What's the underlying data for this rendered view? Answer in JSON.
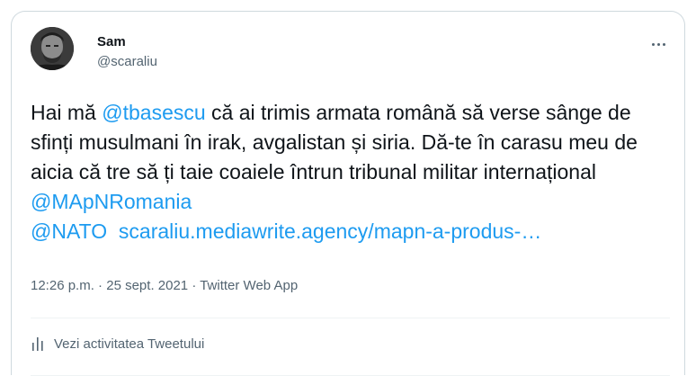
{
  "author": {
    "name": "Sam",
    "handle": "@scaraliu",
    "avatar_icon": "user-avatar"
  },
  "menu_icon": "more-horizontal-icon",
  "tweet": {
    "line1_pre": "Hai mă ",
    "mention1": "@tbasescu",
    "line1_post": " că ai trimis armata română să verse sânge de sfinți musulmani în irak, avgalistan și siria. Dă-te în carasu meu de aicia că tre să ți taie coaiele întrun tribunal militar internațional ",
    "mention2": "@MApNRomania",
    "mention3": "@NATO",
    "link": "scaraliu.mediawrite.agency/mapn-a-produs-…"
  },
  "meta": {
    "time": "12:26 p.m.",
    "sep1": " · ",
    "date": "25 sept. 2021",
    "sep2": " · ",
    "source": "Twitter Web App"
  },
  "activity": {
    "icon": "analytics-icon",
    "label": "Vezi activitatea Tweetului"
  },
  "colors": {
    "link": "#1d9bf0",
    "text": "#0f1419",
    "secondary": "#536471",
    "border": "#cfd9de"
  }
}
